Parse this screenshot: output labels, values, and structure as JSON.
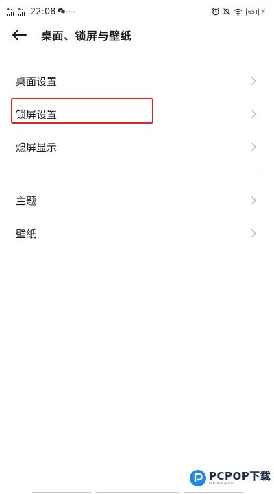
{
  "status_bar": {
    "networks": [
      "4G",
      "4G"
    ],
    "time": "22:08",
    "extra_dots": "···",
    "battery": "65"
  },
  "header": {
    "title": "桌面、锁屏与壁纸"
  },
  "groups": [
    {
      "items": [
        {
          "label": "桌面设置"
        },
        {
          "label": "锁屏设置"
        },
        {
          "label": "熄屏显示"
        }
      ]
    },
    {
      "items": [
        {
          "label": "主题"
        },
        {
          "label": "壁纸"
        }
      ]
    }
  ],
  "watermark": {
    "main": "PCPOP下载",
    "sub": "PCPOP Download"
  },
  "colors": {
    "highlight": "#d62828",
    "text": "#1a1a1a",
    "chevron": "#bdbdbd"
  }
}
